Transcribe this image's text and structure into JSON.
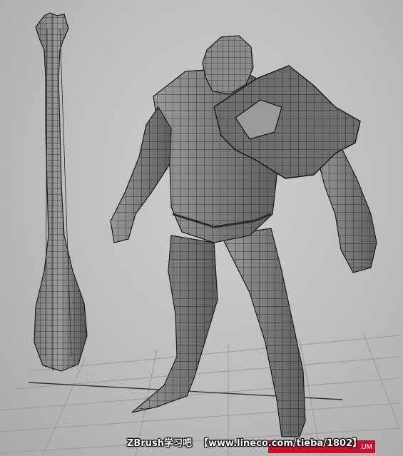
{
  "watermark": {
    "brand": "ZBrush学习吧",
    "url": "【www.lineco.com/tieba/1802】",
    "stamp": "UM"
  },
  "colors": {
    "background": "#c4c4c4",
    "mesh_fill": "#8a8a8a",
    "wire": "#1c1c1c",
    "grid": "#9a9a9a",
    "stamp": "#c8102e"
  },
  "objects": [
    "club-mesh",
    "ogre-mesh",
    "ground-grid"
  ]
}
